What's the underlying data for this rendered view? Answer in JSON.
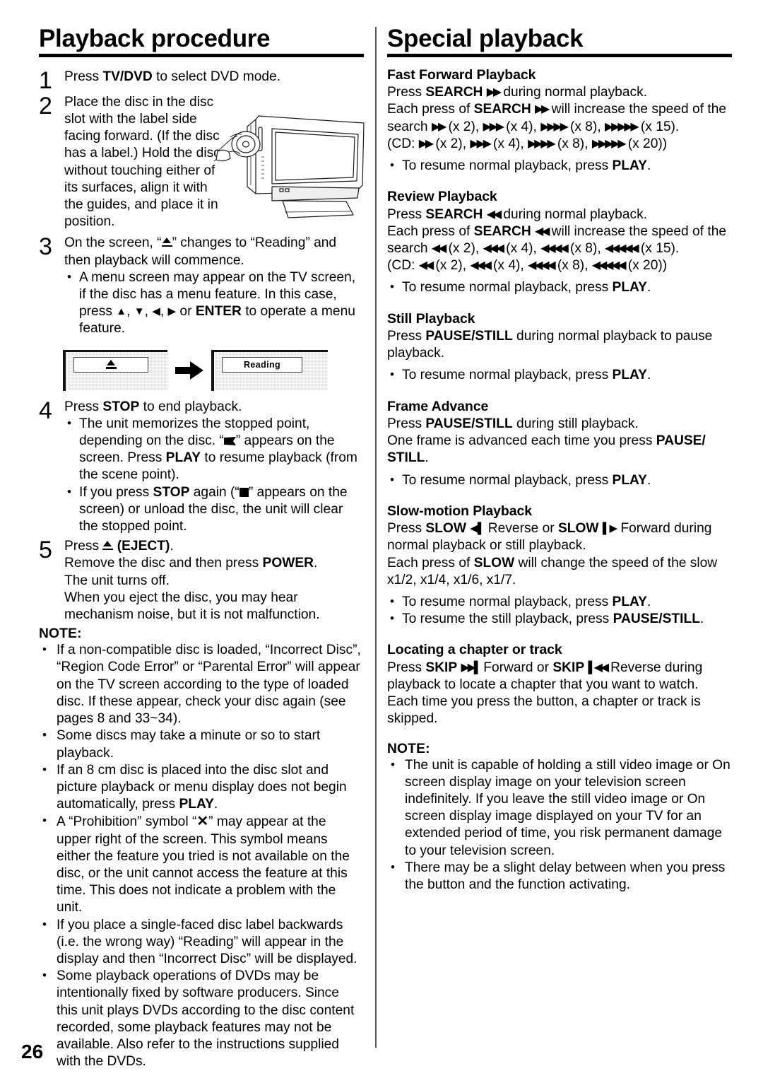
{
  "page_number": "26",
  "left_column": {
    "title": "Playback procedure",
    "steps": [
      {
        "number": "1",
        "text_parts": [
          {
            "t": "Press ",
            "b": false
          },
          {
            "t": "TV/DVD",
            "b": true
          },
          {
            "t": " to select DVD mode.",
            "b": false
          }
        ]
      },
      {
        "number": "2",
        "text": "Place the disc in the disc slot with the label side facing forward. (If the disc has a label.) Hold the disc without touching either of its surfaces, align it with the guides, and place it in position."
      },
      {
        "number": "3",
        "text_lead": "On the screen, “⏏” changes to “Reading” and then playback will commence.",
        "bullets": [
          "A menu screen may appear on the TV screen, if the disc has a menu feature. In this case, press ▲, ▼, ◀, ▶ or ENTER to operate a menu feature."
        ]
      },
      {
        "number": "4",
        "text_lead": "Press STOP to end playback.",
        "bullets": [
          "The unit memorizes the stopped point, depending on the disc. “⚑” appears on the screen. Press PLAY to resume playback (from the scene point).",
          "If you press STOP again (“■” appears on the screen) or unload the disc, the unit will clear the stopped point."
        ]
      },
      {
        "number": "5",
        "lines": [
          "Press ⏏ (EJECT).",
          "Remove the disc and then press POWER.",
          "The unit turns off.",
          "When you eject the disc, you may hear",
          "mechanism noise, but it is not malfunction."
        ]
      }
    ],
    "screens_illustration": {
      "first_osd": "",
      "first_osd_icon": "eject-icon",
      "second_osd": "Reading",
      "arrow": "right-block-arrow"
    },
    "note_label": "NOTE:",
    "notes": [
      "If a non-compatible disc is loaded, “Incorrect Disc”, “Region Code Error” or “Parental Error” will appear on the TV screen according to the type of loaded disc. If these appear, check your disc again (see pages 8 and 33~34).",
      "Some discs may take a minute or so to start playback.",
      "If an 8 cm disc is placed into the disc slot and picture playback or menu display does not begin automatically, press PLAY.",
      "A “Prohibition” symbol “✕” may appear at the upper right of the screen. This symbol means either the feature you tried is not available on the disc, or the unit cannot access the feature at this time. This does not indicate a problem with the unit.",
      "If you place a single-faced disc label backwards (i.e. the wrong way) “Reading” will appear in the display and then “Incorrect Disc” will be displayed.",
      "Some playback operations of DVDs may be intentionally fixed by software producers. Since this unit plays DVDs according to the disc content recorded, some playback features may not be available. Also refer to the instructions supplied with the DVDs."
    ]
  },
  "right_column": {
    "title": "Special playback",
    "sections": [
      {
        "heading": "Fast Forward Playback",
        "body_lines": [
          "Press SEARCH ▶▶ during normal playback.",
          "Each press of SEARCH ▶▶ will increase the speed of the search ▶▶ (x 2), ▶▶▶ (x 4), ▶▶▶▶ (x 8), ▶▶▶▶▶ (x 15).",
          "(CD: ▶▶ (x 2), ▶▶▶ (x 4), ▶▶▶▶ (x 8), ▶▶▶▶▶ (x 20))"
        ],
        "bullets": [
          "To resume normal playback, press PLAY."
        ]
      },
      {
        "heading": "Review Playback",
        "body_lines": [
          "Press SEARCH ◀◀ during normal playback.",
          "Each press of SEARCH ◀◀ will increase the speed of the search ◀◀ (x 2), ◀◀◀ (x 4), ◀◀◀◀ (x 8), ◀◀◀◀◀ (x 15).",
          "(CD: ◀◀ (x 2), ◀◀◀ (x 4), ◀◀◀◀ (x 8), ◀◀◀◀◀ (x 20))"
        ],
        "bullets": [
          "To resume normal playback, press PLAY."
        ]
      },
      {
        "heading": "Still Playback",
        "body_lines": [
          "Press PAUSE/STILL during normal playback to pause playback."
        ],
        "bullets": [
          "To resume normal playback, press PLAY."
        ]
      },
      {
        "heading": "Frame Advance",
        "body_lines": [
          "Press PAUSE/STILL during still playback.",
          "One frame is advanced each time you press PAUSE/STILL."
        ],
        "bullets": [
          "To resume normal playback, press PLAY."
        ]
      },
      {
        "heading": "Slow-motion Playback",
        "body_lines": [
          "Press SLOW ◀| Reverse or SLOW |▶ Forward during normal playback or still playback.",
          "Each press of SLOW will change the speed of the slow x1/2, x1/4, x1/6, x1/7."
        ],
        "bullets": [
          "To resume normal playback, press PLAY.",
          "To resume the still playback, press PAUSE/STILL."
        ]
      },
      {
        "heading": "Locating a chapter or track",
        "body_lines": [
          "Press SKIP ▶▶| Forward or SKIP |◀◀ Reverse during playback to locate a chapter that you want to watch.",
          "Each time you press the button, a chapter or track is skipped."
        ],
        "bullets": []
      }
    ],
    "note_label": "NOTE:",
    "notes": [
      "The unit is capable of holding a still video image or On screen display image on your television screen indefinitely. If you leave the still video image or On screen display image displayed on your TV for an extended period of time, you risk permanent damage to your television screen.",
      "There may be a slight delay between when you press the button and the function activating."
    ]
  }
}
